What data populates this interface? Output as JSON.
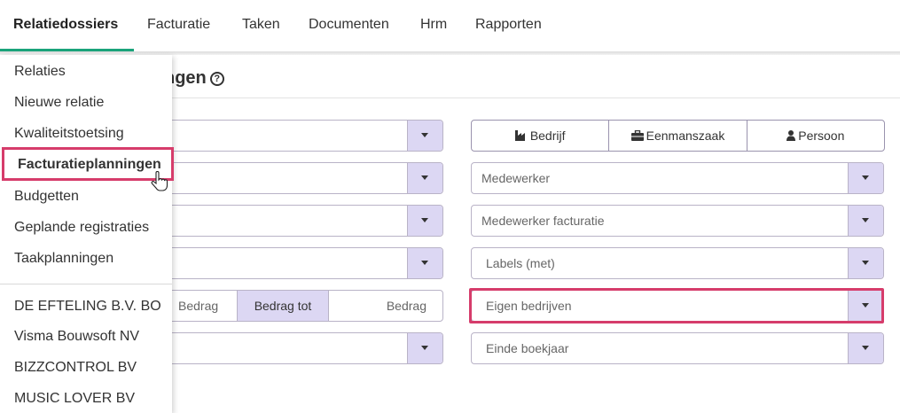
{
  "nav": {
    "tabs": [
      {
        "label": "Relatiedossiers"
      },
      {
        "label": "Facturatie"
      },
      {
        "label": "Taken"
      },
      {
        "label": "Documenten"
      },
      {
        "label": "Hrm"
      },
      {
        "label": "Rapporten"
      }
    ]
  },
  "page": {
    "title": "ngen",
    "help": "?"
  },
  "menu": {
    "items": [
      {
        "label": "Relaties"
      },
      {
        "label": "Nieuwe relatie"
      },
      {
        "label": "Kwaliteitstoetsing"
      },
      {
        "label": "Facturatieplanningen"
      },
      {
        "label": "Budgetten"
      },
      {
        "label": "Geplande registraties"
      },
      {
        "label": "Taakplanningen"
      }
    ],
    "recent": [
      {
        "label": "DE EFTELING B.V. BO"
      },
      {
        "label": "Visma Bouwsoft NV"
      },
      {
        "label": "BIZZCONTROL BV"
      },
      {
        "label": "MUSIC LOVER BV"
      }
    ]
  },
  "filters": {
    "type_buttons": [
      {
        "label": "Bedrijf",
        "icon": "factory-icon"
      },
      {
        "label": "Eenmanszaak",
        "icon": "briefcase-icon"
      },
      {
        "label": "Persoon",
        "icon": "person-icon"
      }
    ],
    "medewerker": "Medewerker",
    "medewerker_facturatie": "Medewerker facturatie",
    "labels": "Labels (met)",
    "eigen_bedrijven": "Eigen bedrijven",
    "einde_boekjaar": "Einde boekjaar",
    "amount": {
      "from_placeholder": "Bedrag",
      "mode_label": "Bedrag tot",
      "to_placeholder": "Bedrag"
    }
  },
  "colors": {
    "accent": "#1aa37a",
    "dropdown_button": "#dcd7f3",
    "highlight": "#d63c6b"
  }
}
